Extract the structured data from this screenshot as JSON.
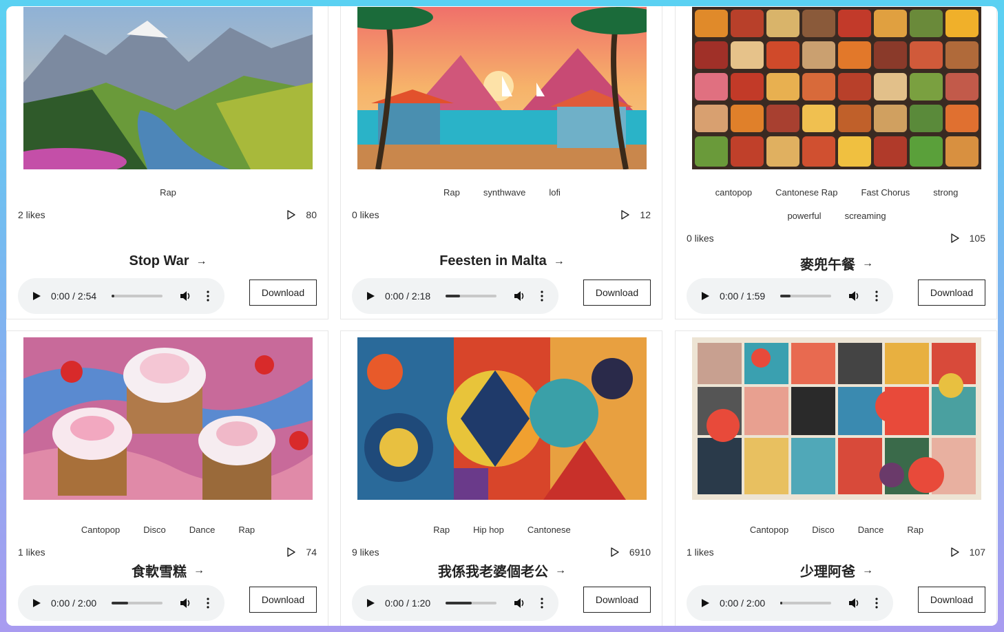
{
  "cards": [
    {
      "image": "mountain-lake-valley-artwork",
      "tags": [
        "Rap"
      ],
      "likes": "2 likes",
      "plays": "80",
      "title": "Stop War",
      "time_current": "0:00",
      "time_total": "2:54",
      "progress": 0.06,
      "download_label": "Download"
    },
    {
      "image": "tropical-beach-sunset-artwork",
      "tags": [
        "Rap",
        "synthwave",
        "lofi"
      ],
      "likes": "0 likes",
      "plays": "12",
      "title": "Feesten in Malta",
      "time_current": "0:00",
      "time_total": "2:18",
      "progress": 0.28,
      "download_label": "Download"
    },
    {
      "image": "food-grid-collage",
      "tags": [
        "cantopop",
        "Cantonese Rap",
        "Fast Chorus",
        "strong",
        "powerful",
        "screaming"
      ],
      "likes": "0 likes",
      "plays": "105",
      "title": "麥兜午餐",
      "time_current": "0:00",
      "time_total": "1:59",
      "progress": 0.2,
      "download_label": "Download"
    },
    {
      "image": "cupcakes-strawberries-artwork",
      "tags": [
        "Cantopop",
        "Disco",
        "Dance",
        "Rap"
      ],
      "likes": "1 likes",
      "plays": "74",
      "title": "食軟雪糕",
      "time_current": "0:00",
      "time_total": "2:00",
      "progress": 0.33,
      "download_label": "Download"
    },
    {
      "image": "abstract-geometric-shapes",
      "tags": [
        "Rap",
        "Hip hop",
        "Cantonese"
      ],
      "likes": "9 likes",
      "plays": "6910",
      "title": "我係我老婆個老公",
      "time_current": "0:00",
      "time_total": "1:20",
      "progress": 0.52,
      "download_label": "Download"
    },
    {
      "image": "patterned-patchwork-tiles",
      "tags": [
        "Cantopop",
        "Disco",
        "Dance",
        "Rap"
      ],
      "likes": "1 likes",
      "plays": "107",
      "title": "少理阿爸",
      "time_current": "0:00",
      "time_total": "2:00",
      "progress": 0.04,
      "download_label": "Download"
    }
  ],
  "icons": {
    "plays": "play-outline-icon",
    "title_link": "arrow-right-icon",
    "player_play": "play-icon",
    "volume": "volume-icon",
    "more": "more-vertical-icon"
  }
}
